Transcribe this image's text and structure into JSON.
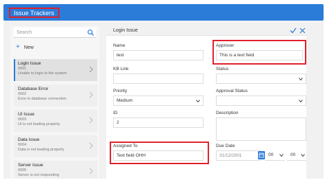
{
  "header": {
    "title": "Issue Trackers"
  },
  "sidebar": {
    "search_placeholder": "Search",
    "new_label": "New",
    "items": [
      {
        "title": "Login Issue",
        "id": "0001",
        "desc": "Unable to login to the system",
        "active": true
      },
      {
        "title": "Database Error",
        "id": "0002",
        "desc": "Error in database connection",
        "active": false
      },
      {
        "title": "UI Issue",
        "id": "0003",
        "desc": "UI is not loading properly",
        "active": false
      },
      {
        "title": "Data Issue",
        "id": "0004",
        "desc": "Data is not loading properly",
        "active": false
      },
      {
        "title": "Server Issue",
        "id": "0005",
        "desc": "Server is not responding",
        "active": false
      }
    ]
  },
  "form": {
    "title": "Login Issue",
    "name_label": "Name",
    "name_value": "test",
    "approver_label": "Approver",
    "approver_value": "This is a text field",
    "kblink_label": "KB Link",
    "kblink_value": "",
    "status_label": "Status",
    "status_value": "",
    "priority_label": "Priority",
    "priority_value": "Medium",
    "approval_status_label": "Approval Status",
    "approval_status_value": "",
    "id_label": "ID",
    "id_value": "2",
    "description_label": "Description",
    "description_value": "",
    "assigned_label": "Assigned To",
    "assigned_value": "Text field OHH",
    "due_label": "Due Date",
    "due_date_value": "31/12/2001",
    "due_hour_value": "00",
    "due_minute_value": "00"
  },
  "colors": {
    "accent": "#2b7bd8",
    "highlight": "#e0202a"
  }
}
